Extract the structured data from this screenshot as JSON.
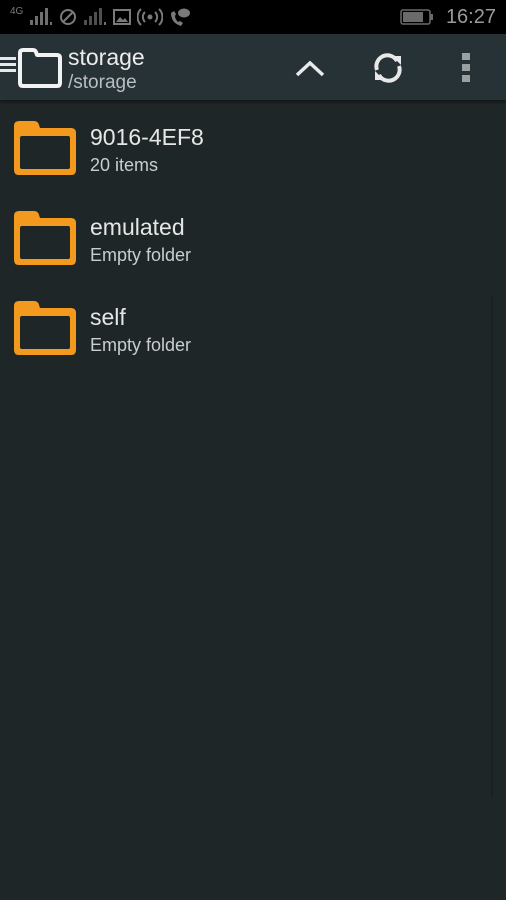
{
  "status_bar": {
    "network_label": "4G",
    "sim1_signal": "signal-bars-sim1",
    "sim2_signal": "signal-bars-sim2",
    "time": "16:27",
    "battery_level_percent": 70
  },
  "app_bar": {
    "title": "storage",
    "path": "/storage"
  },
  "folders": [
    {
      "name": "9016-4EF8",
      "meta": "20 items"
    },
    {
      "name": "emulated",
      "meta": "Empty folder"
    },
    {
      "name": "self",
      "meta": "Empty folder"
    }
  ],
  "colors": {
    "folder_accent": "#f39a1e",
    "app_bar": "#273236",
    "background": "#1f2628"
  }
}
